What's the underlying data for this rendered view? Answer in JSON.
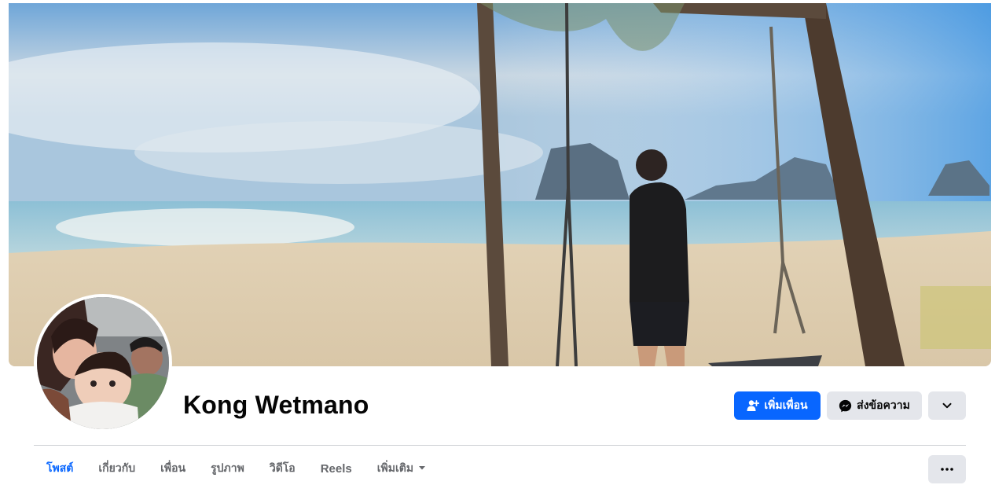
{
  "profile": {
    "name": "Kong Wetmano"
  },
  "actions": {
    "add_friend_label": "เพิ่มเพื่อน",
    "add_friend_icon": "person-add-icon",
    "message_label": "ส่งข้อความ",
    "message_icon": "messenger-icon",
    "expand_icon": "chevron-down-icon"
  },
  "tabs": [
    {
      "label": "โพสต์",
      "active": true
    },
    {
      "label": "เกี่ยวกับ",
      "active": false
    },
    {
      "label": "เพื่อน",
      "active": false
    },
    {
      "label": "รูปภาพ",
      "active": false
    },
    {
      "label": "วิดีโอ",
      "active": false
    },
    {
      "label": "Reels",
      "active": false
    },
    {
      "label": "เพิ่มเติม",
      "active": false,
      "icon": "caret-down-icon"
    }
  ],
  "more_options_icon": "ellipsis-icon",
  "colors": {
    "primary": "#0866ff",
    "secondary_button": "#e4e6eb",
    "text": "#050505",
    "muted_text": "#65676b",
    "divider": "#ced0d4"
  }
}
